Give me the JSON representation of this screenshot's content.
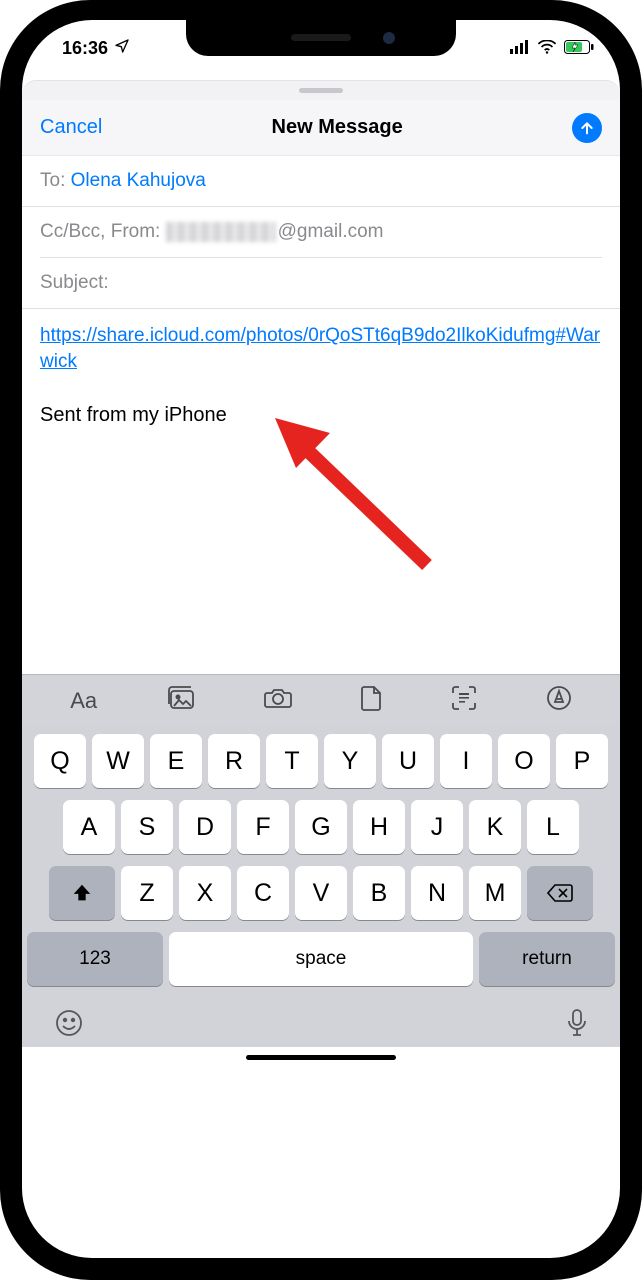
{
  "statusbar": {
    "time": "16:36"
  },
  "nav": {
    "cancel": "Cancel",
    "title": "New Message"
  },
  "compose": {
    "to_label": "To:",
    "to_value": "Olena Kahujova",
    "from_label": "Cc/Bcc, From:",
    "from_domain": "@gmail.com",
    "subject_label": "Subject:",
    "link_text": "https://share.icloud.com/photos/0rQoSTt6qB9do2IlkoKidufmg#Warwick",
    "signature": "Sent from my iPhone"
  },
  "kb_toolbar": {
    "text_style": "Aa"
  },
  "keyboard": {
    "row1": [
      "Q",
      "W",
      "E",
      "R",
      "T",
      "Y",
      "U",
      "I",
      "O",
      "P"
    ],
    "row2": [
      "A",
      "S",
      "D",
      "F",
      "G",
      "H",
      "J",
      "K",
      "L"
    ],
    "row3": [
      "Z",
      "X",
      "C",
      "V",
      "B",
      "N",
      "M"
    ],
    "numkey": "123",
    "space": "space",
    "return": "return"
  }
}
